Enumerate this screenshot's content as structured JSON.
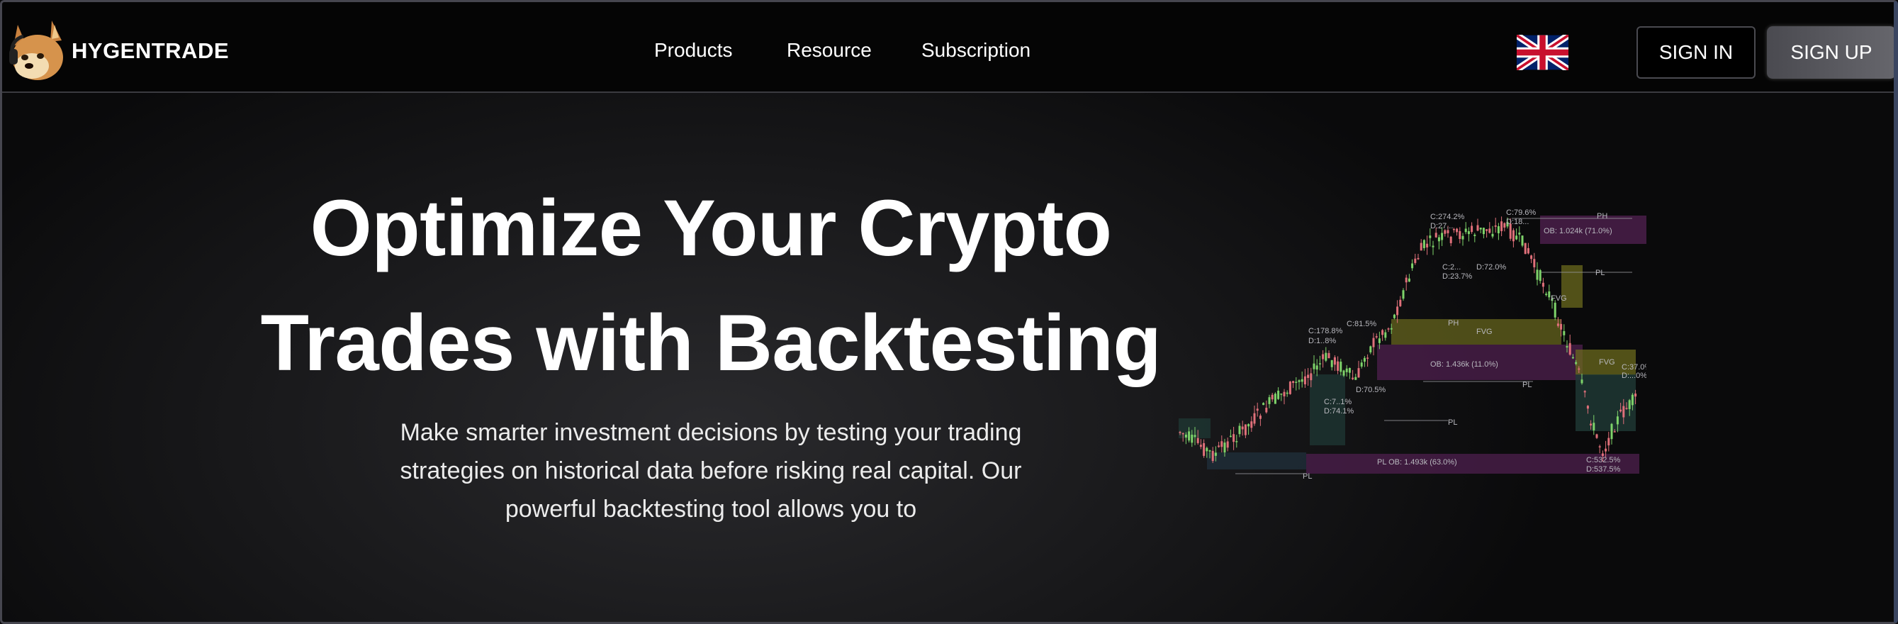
{
  "header": {
    "brand": "HYGENTRADE",
    "nav": [
      "Products",
      "Resource",
      "Subscription"
    ],
    "language_icon": "uk-flag-icon",
    "sign_in": "SIGN IN",
    "sign_up": "SIGN UP"
  },
  "hero": {
    "title_line1": "Optimize Your Crypto",
    "title_line2": "Trades with Backtesting",
    "description": "Make smarter investment decisions by testing your trading strategies on historical data before risking real capital. Our powerful backtesting tool allows you to",
    "chart_labels": {
      "c1": "C:274.2%",
      "d1": "D:27...",
      "c2": "C:79.6%",
      "d2": "D:18...",
      "ph1": "PH",
      "ob1": "OB: 1.024k (71.0%)",
      "c3": "C:2...",
      "d3": "D:23.7%",
      "d4": "D:72.0%",
      "pl1": "PL",
      "fvg1": "FVG",
      "c4": "C:178.8%",
      "d5": "D:1..8%",
      "c5": "C:81.5%",
      "ph2": "PH",
      "fvg2": "FVG",
      "ob2": "OB: 1.436k (11.0%)",
      "pl2": "PL",
      "fvg3": "FVG",
      "c6": "C:37.0%",
      "d6": "D:...0%",
      "d7": "D:70.5%",
      "c7": "C:7..1%",
      "d8": "D:74.1%",
      "pl3": "PL",
      "ob3": "PL OB: 1.493k (63.0%)",
      "c8": "C:532.5%",
      "d9": "D:537.5%",
      "pl4": "PL"
    }
  },
  "colors": {
    "bullish": "#7ed36a",
    "bearish": "#e0707a",
    "zone_olive": "#6b6a1e",
    "zone_purple": "#4a1e4a",
    "zone_teal": "#1f3a36"
  }
}
